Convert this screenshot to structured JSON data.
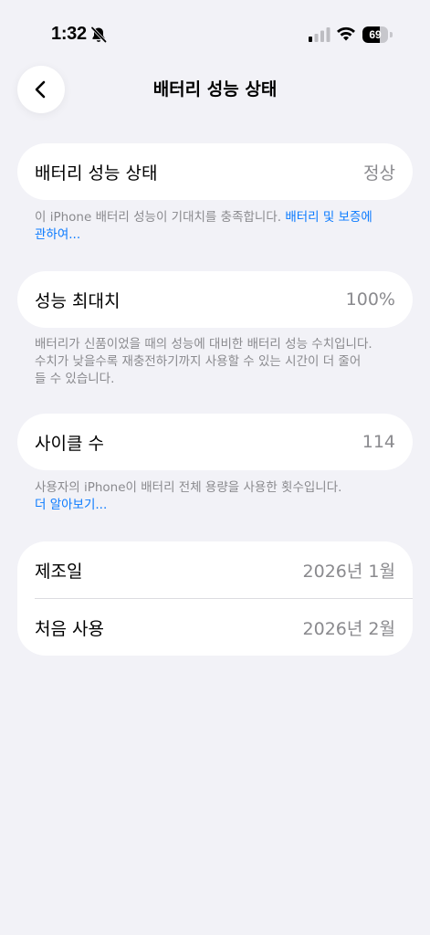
{
  "status_bar": {
    "time": "1:32",
    "battery_percent": "69",
    "battery_level": 0.69
  },
  "nav": {
    "title": "배터리 성능 상태"
  },
  "health_card": {
    "label": "배터리 성능 상태",
    "value": "정상"
  },
  "health_note": {
    "text": "이 iPhone 배터리 성능이 기대치를 충족합니다. ",
    "link_line1": "배터리 및 보증에",
    "link_line2": "관하여..."
  },
  "capacity_card": {
    "label": "성능 최대치",
    "value": "100%"
  },
  "capacity_note": {
    "line1": "배터리가 신품이었을 때의 성능에 대비한 배터리 성능 수치입니다.",
    "line2": "수치가 낮을수록 재충전하기까지 사용할 수 있는 시간이 더 줄어",
    "line3": "들 수 있습니다."
  },
  "cycle_card": {
    "label": "사이클 수",
    "value": "114"
  },
  "cycle_note": {
    "text": "사용자의 iPhone이 배터리 전체 용량을 사용한 횟수입니다.",
    "link": "더 알아보기..."
  },
  "dates_card": {
    "manufactured_label": "제조일",
    "manufactured_value": "2026년 1월",
    "first_use_label": "처음 사용",
    "first_use_value": "2026년 2월"
  },
  "colors": {
    "background": "#f2f2f7",
    "card": "#ffffff",
    "link": "#0a7aff",
    "secondary_text": "#8a8a8e"
  }
}
